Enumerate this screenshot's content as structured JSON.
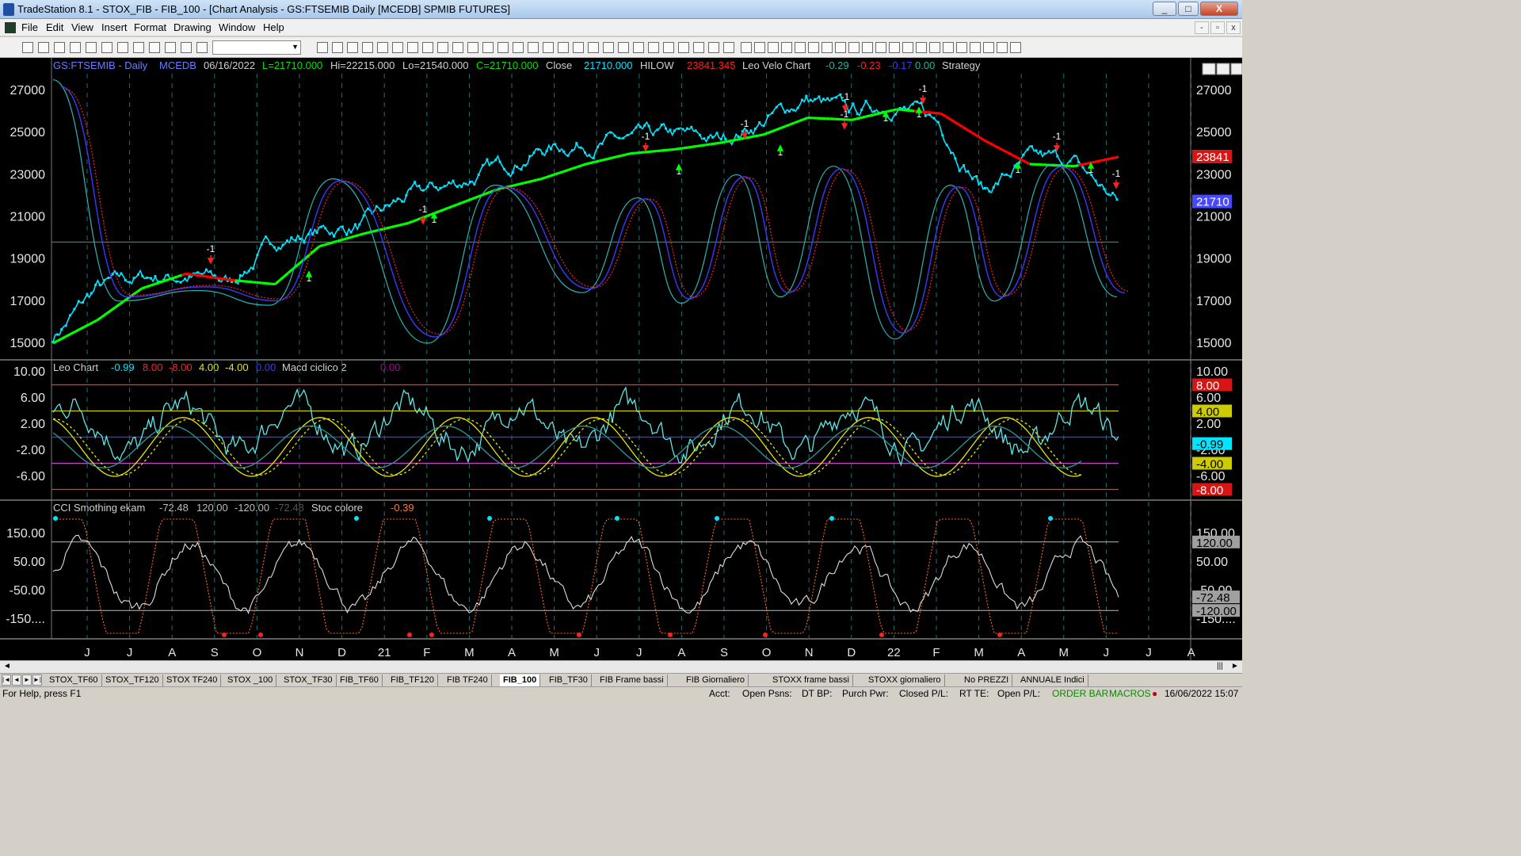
{
  "window": {
    "title": "TradeStation 8.1 - STOX_FIB - FIB_100 - [Chart Analysis - GS:FTSEMIB  Daily  [MCEDB] SPMIB FUTURES]",
    "minimize": "_",
    "maximize": "□",
    "close": "X"
  },
  "menu": [
    "File",
    "Edit",
    "View",
    "Insert",
    "Format",
    "Drawing",
    "Window",
    "Help"
  ],
  "chart": {
    "header": {
      "symbol": "GS:FTSEMIB - Daily",
      "data": "MCEDB",
      "date": "06/16/2022",
      "last": "L=21710.000",
      "high": "Hi=22215.000",
      "low": "Lo=21540.000",
      "close_eq": "C=21710.000",
      "close_label": "Close",
      "close_value": "21710.000",
      "hilow_label": "HILOW",
      "hilow_value": "23841.345",
      "velo_label": "Leo Velo Chart",
      "velo_v1": "-0.29",
      "velo_v2": "-0.23",
      "velo_v3": "-0.17",
      "velo_v4": "0.00",
      "strategy": "Strategy"
    },
    "price_axis": [
      "27000",
      "25000",
      "23000",
      "21000",
      "19000",
      "17000",
      "15000"
    ],
    "price_badges": {
      "hilow": "23841",
      "last": "21710"
    },
    "leo_header": {
      "name": "Leo Chart",
      "v1": "-0.99",
      "v2": "8.00",
      "v3": "-8.00",
      "v4": "4.00",
      "v5": "-4.00",
      "v6": "0.00",
      "macd_label": "Macd ciclico 2",
      "macd_value": "0.00"
    },
    "leo_axis": [
      "10.00",
      "6.00",
      "2.00",
      "-2.00",
      "-6.00"
    ],
    "leo_badges": [
      "8.00",
      "4.00",
      "-0.99",
      "-4.00",
      "-8.00"
    ],
    "cci_header": {
      "name": "CCI Smothing ekam",
      "v1": "-72.48",
      "v2": "120.00",
      "v3": "-120.00",
      "v4": "-72.48",
      "stoc_label": "Stoc colore",
      "stoc_value": "-0.39"
    },
    "cci_axis": [
      "150.00",
      "50.00",
      "-50.00",
      "-150...."
    ],
    "cci_badges": [
      "120.00",
      "-72.48",
      "-120.00"
    ],
    "time_axis": [
      "J",
      "J",
      "A",
      "S",
      "O",
      "N",
      "D",
      "21",
      "F",
      "M",
      "A",
      "M",
      "J",
      "J",
      "A",
      "S",
      "O",
      "N",
      "D",
      "22",
      "F",
      "M",
      "A",
      "M",
      "J",
      "J",
      "A"
    ],
    "signal_labels": [
      "-1",
      "1",
      "-1",
      "1",
      "-1",
      "1",
      "-1",
      "1",
      "-1",
      "1",
      "-1",
      "1",
      "-1",
      "1",
      "-1",
      "1",
      "-1"
    ]
  },
  "chart_data": [
    {
      "type": "line",
      "title": "GS:FTSEMIB - Daily",
      "x": [
        "2020-06",
        "2020-07",
        "2020-08",
        "2020-09",
        "2020-10",
        "2020-11",
        "2020-12",
        "2021-01",
        "2021-02",
        "2021-03",
        "2021-04",
        "2021-05",
        "2021-06",
        "2021-07",
        "2021-08",
        "2021-09",
        "2021-10",
        "2021-11",
        "2021-12",
        "2022-01",
        "2022-02",
        "2022-03",
        "2022-04",
        "2022-05",
        "2022-06"
      ],
      "series": [
        {
          "name": "Close",
          "values": [
            15300,
            17600,
            18100,
            18200,
            17900,
            19800,
            20300,
            20600,
            21900,
            22500,
            23300,
            24200,
            24500,
            24600,
            24800,
            24600,
            25500,
            26600,
            25900,
            26400,
            25400,
            22300,
            23600,
            23600,
            21710
          ]
        },
        {
          "name": "HILOW",
          "values": [
            15000,
            16100,
            17600,
            18300,
            18000,
            17800,
            19600,
            20200,
            20700,
            21500,
            22300,
            22800,
            23500,
            24000,
            24200,
            24500,
            24900,
            25700,
            25600,
            26100,
            25900,
            24600,
            23500,
            23400,
            23841
          ]
        }
      ],
      "ylim": [
        14500,
        27800
      ]
    },
    {
      "type": "line",
      "title": "Leo Chart",
      "series": [
        {
          "name": "Leo Chart",
          "values": [
            -0.99
          ]
        },
        {
          "name": "Macd ciclico 2",
          "values": [
            0.0
          ]
        }
      ],
      "levels": [
        8.0,
        -8.0,
        4.0,
        -4.0,
        0.0
      ],
      "ylim": [
        -9.5,
        11
      ]
    },
    {
      "type": "line",
      "title": "CCI Smothing ekam",
      "series": [
        {
          "name": "CCI Smothing ekam",
          "values": [
            -72.48
          ]
        },
        {
          "name": "Stoc colore",
          "values": [
            -0.39
          ]
        }
      ],
      "levels": [
        120.0,
        -120.0
      ],
      "ylim": [
        -200,
        220
      ]
    }
  ],
  "tabs": [
    "STOX_TF60",
    "STOX_TF120",
    "STOX TF240",
    "STOX _100",
    "STOX_TF30",
    "FIB_TF60",
    "FIB_TF120",
    "FIB TF240",
    "FIB_100",
    "FIB_TF30",
    "FIB Frame bassi",
    "FIB Giornaliero",
    "STOXX frame bassi",
    "STOXX giornaliero",
    "No PREZZI",
    "ANNUALE Indici"
  ],
  "active_tab": "FIB_100",
  "status": {
    "help": "For Help, press F1",
    "acct": "Acct:",
    "open_psns": "Open Psns:",
    "dt_bp": "DT BP:",
    "purch_pwr": "Purch Pwr:",
    "closed_pl": "Closed P/L:",
    "rt_te": "RT TE:",
    "open_pl": "Open P/L:",
    "order_bar": "ORDER BAR",
    "macros": "MACROS",
    "datetime": "16/06/2022 15:07"
  },
  "colors": {
    "price": "#00e5ff",
    "hilow_up": "#00ff00",
    "hilow_down": "#ff0000",
    "osc_cyan": "#5fe6e6",
    "osc_blue": "#3a3aff",
    "osc_red": "#ff2020",
    "leo_yellow": "#e8e800",
    "level_red": "#ff3030",
    "level_yellow": "#cccc00"
  }
}
